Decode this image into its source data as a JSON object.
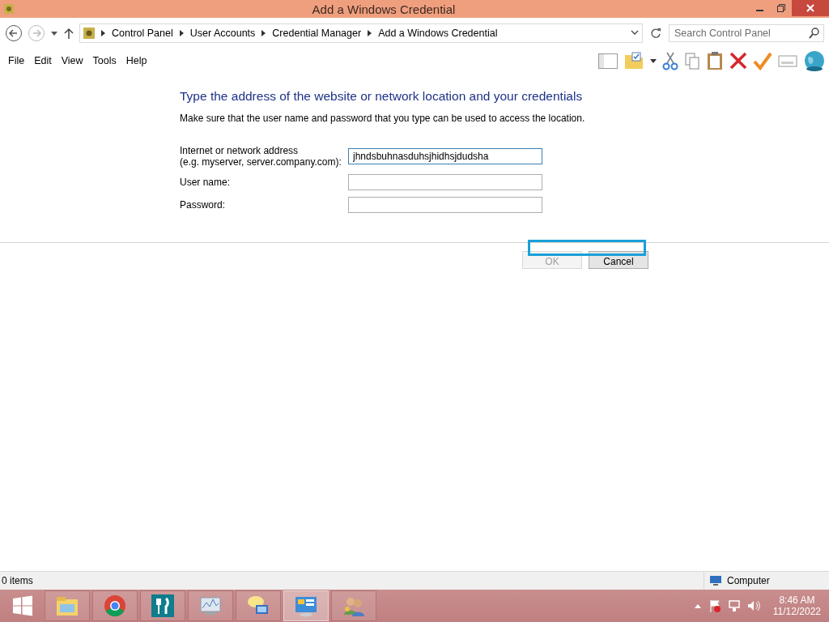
{
  "window": {
    "title": "Add a Windows Credential"
  },
  "address_bar": {
    "breadcrumbs": [
      "Control Panel",
      "User Accounts",
      "Credential Manager",
      "Add a Windows Credential"
    ],
    "search_placeholder": "Search Control Panel"
  },
  "menu": [
    "File",
    "Edit",
    "View",
    "Tools",
    "Help"
  ],
  "form": {
    "heading": "Type the address of the website or network location and your credentials",
    "description": "Make sure that the user name and password that you type can be used to access the location.",
    "fields": [
      {
        "label": "Internet or network address",
        "hint": "(e.g. myserver, server.company.com):",
        "value": "jhndsbuhnasduhsjhidhsjdudsha",
        "focused": true
      },
      {
        "label": "User name:",
        "focused": false
      },
      {
        "label": "Password:",
        "focused": false
      }
    ],
    "buttons": [
      {
        "label": "OK",
        "disabled": true
      },
      {
        "label": "Cancel",
        "disabled": false
      }
    ]
  },
  "status_bar": {
    "items": "0 items",
    "location": "Computer"
  },
  "taskbar": {
    "apps": [
      {
        "kind": "explorer",
        "selected": false
      },
      {
        "kind": "chrome",
        "selected": false
      },
      {
        "kind": "cutlery",
        "selected": false
      },
      {
        "kind": "monitor",
        "selected": false
      },
      {
        "kind": "chat",
        "selected": false
      },
      {
        "kind": "control",
        "selected": true
      },
      {
        "kind": "users",
        "selected": false
      }
    ],
    "time": "8:46 AM",
    "date": "11/12/2022"
  }
}
